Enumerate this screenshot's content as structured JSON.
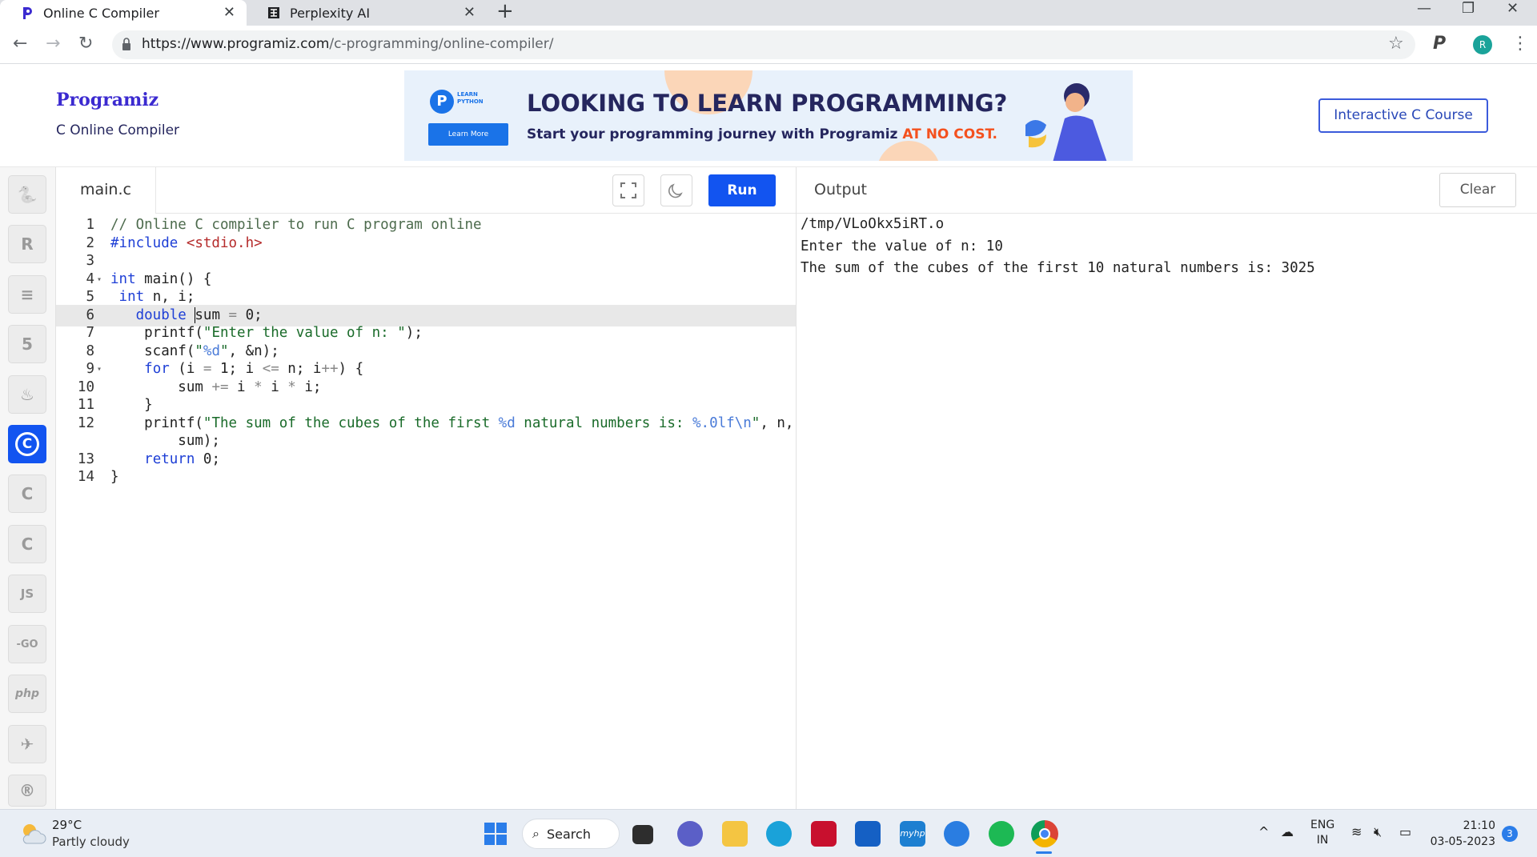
{
  "browser": {
    "tabs": [
      {
        "title": "Online C Compiler",
        "active": true
      },
      {
        "title": "Perplexity AI",
        "active": false
      }
    ],
    "url_scheme_host": "https://www.programiz.com",
    "url_path": "/c-programming/online-compiler/",
    "profile_initial": "R",
    "extension_label": "P"
  },
  "header": {
    "logo_text": "Programiz",
    "subtitle": "C Online Compiler",
    "course_button": "Interactive C Course"
  },
  "banner": {
    "badge_text": "LEARN PYTHON",
    "learn_more": "Learn More",
    "headline": "LOOKING TO LEARN PROGRAMMING?",
    "subline_main": "Start your programming journey with Programiz ",
    "subline_highlight": "AT NO COST."
  },
  "sidebar": {
    "languages": [
      {
        "name": "python",
        "glyph": "🐍"
      },
      {
        "name": "r",
        "glyph": "R"
      },
      {
        "name": "sql",
        "glyph": "≡"
      },
      {
        "name": "html",
        "glyph": "5"
      },
      {
        "name": "java",
        "glyph": "♨"
      },
      {
        "name": "c",
        "glyph": "C",
        "active": true
      },
      {
        "name": "cpp",
        "glyph": "C"
      },
      {
        "name": "csharp",
        "glyph": "C"
      },
      {
        "name": "javascript",
        "glyph": "JS"
      },
      {
        "name": "go",
        "glyph": "-GO"
      },
      {
        "name": "php",
        "glyph": "php"
      },
      {
        "name": "swift",
        "glyph": "✈"
      },
      {
        "name": "rust",
        "glyph": "®"
      }
    ]
  },
  "editor": {
    "filename": "main.c",
    "run_label": "Run",
    "fullscreen_icon": "fullscreen-icon",
    "theme_icon": "moon-icon",
    "current_line": 6,
    "lines": [
      {
        "num": "1",
        "text": "// Online C compiler to run C program online"
      },
      {
        "num": "2",
        "text": "#include <stdio.h>"
      },
      {
        "num": "3",
        "text": ""
      },
      {
        "num": "4",
        "text": "int main() {",
        "fold": true
      },
      {
        "num": "5",
        "text": " int n, i;"
      },
      {
        "num": "6",
        "text": "   double sum = 0;"
      },
      {
        "num": "7",
        "text": "    printf(\"Enter the value of n: \");"
      },
      {
        "num": "8",
        "text": "    scanf(\"%d\", &n);"
      },
      {
        "num": "9",
        "text": "    for (i = 1; i <= n; i++) {",
        "fold": true
      },
      {
        "num": "10",
        "text": "        sum += i * i * i;"
      },
      {
        "num": "11",
        "text": "    }"
      },
      {
        "num": "12",
        "text": "    printf(\"The sum of the cubes of the first %d natural numbers is: %.0lf\\n\", n,"
      },
      {
        "num": "",
        "text": "        sum);"
      },
      {
        "num": "13",
        "text": "    return 0;"
      },
      {
        "num": "14",
        "text": "}"
      }
    ]
  },
  "output": {
    "label": "Output",
    "clear_label": "Clear",
    "lines": [
      "/tmp/VLoOkx5iRT.o",
      "Enter the value of n: 10",
      "The sum of the cubes of the first 10 natural numbers is: 3025"
    ]
  },
  "taskbar": {
    "temperature": "29°C",
    "weather": "Partly cloudy",
    "search_label": "Search",
    "lang_line1": "ENG",
    "lang_line2": "IN",
    "time": "21:10",
    "date": "03-05-2023",
    "notification_count": "3"
  },
  "colors": {
    "accent": "#1254f0",
    "brand": "#3b2ad0",
    "highlight": "#f4511e"
  }
}
